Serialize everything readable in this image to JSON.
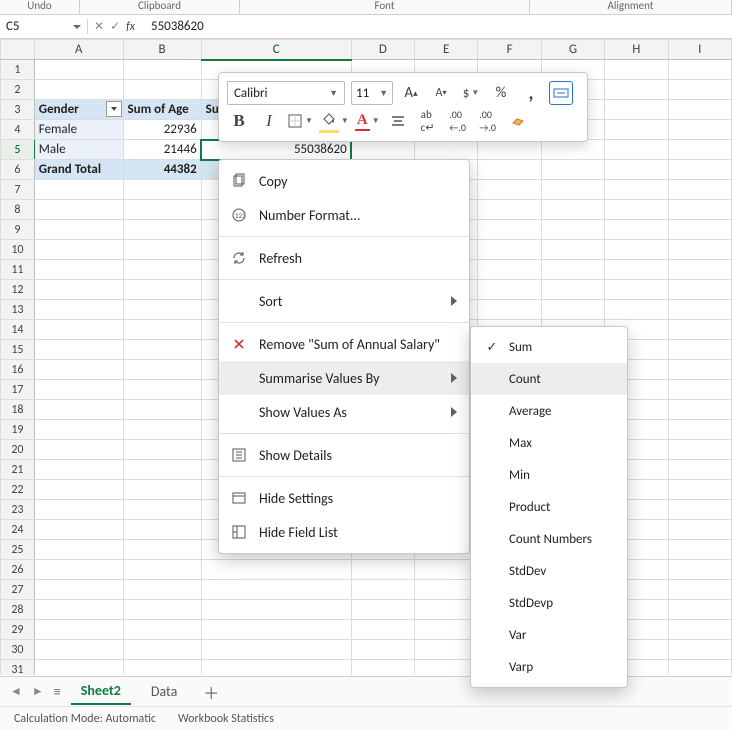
{
  "ribbon_groups": {
    "undo": "Undo",
    "clipboard": "Clipboard",
    "font": "Font",
    "alignment": "Alignment"
  },
  "name_box": "C5",
  "formula": "55038620",
  "columns": [
    "A",
    "B",
    "C",
    "D",
    "E",
    "F",
    "G",
    "H",
    "I"
  ],
  "active_col_index": 2,
  "active_row_index": 4,
  "pivot": {
    "headers": [
      "Gender",
      "Sum of Age",
      "Sum of Annual Salary"
    ],
    "rows": [
      {
        "label": "Female",
        "age": "22936",
        "salary": ""
      },
      {
        "label": "Male",
        "age": "21446",
        "salary": "55038620"
      },
      {
        "label": "Grand Total",
        "age": "44382",
        "salary": "",
        "total": true
      }
    ]
  },
  "mini_toolbar": {
    "font_name": "Calibri",
    "font_size": "11"
  },
  "context_menu": {
    "copy": "Copy",
    "number_format": "Number Format...",
    "refresh": "Refresh",
    "sort": "Sort",
    "remove": "Remove \"Sum of Annual Salary\"",
    "summarise": "Summarise Values By",
    "show_values": "Show Values As",
    "show_details": "Show Details",
    "hide_settings": "Hide Settings",
    "hide_field_list": "Hide Field List"
  },
  "submenu": {
    "items": [
      "Sum",
      "Count",
      "Average",
      "Max",
      "Min",
      "Product",
      "Count Numbers",
      "StdDev",
      "StdDevp",
      "Var",
      "Varp"
    ],
    "checked_index": 0,
    "hover_index": 1
  },
  "sheets": {
    "active": "Sheet2",
    "other": "Data"
  },
  "status": {
    "calc": "Calculation Mode: Automatic",
    "stats": "Workbook Statistics"
  }
}
